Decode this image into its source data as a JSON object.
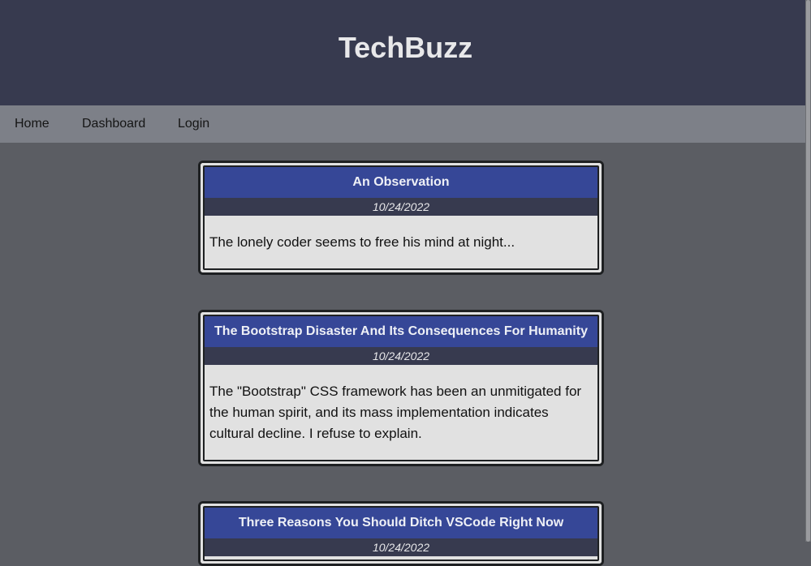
{
  "site": {
    "title": "TechBuzz"
  },
  "nav": {
    "items": [
      "Home",
      "Dashboard",
      "Login"
    ]
  },
  "posts": [
    {
      "title": "An Observation",
      "date": "10/24/2022",
      "body": "The lonely coder seems to free his mind at night..."
    },
    {
      "title": "The Bootstrap Disaster And Its Consequences For Humanity",
      "date": "10/24/2022",
      "body": "The \"Bootstrap\" CSS framework has been an unmitigated for the human spirit, and its mass implementation indicates cultural decline. I refuse to explain."
    },
    {
      "title": "Three Reasons You Should Ditch VSCode Right Now",
      "date": "10/24/2022",
      "body": ""
    }
  ],
  "colors": {
    "header_bg": "#373a4f",
    "nav_bg": "#7d8088",
    "page_bg": "#5b5d63",
    "card_title_bg": "#364797",
    "card_body_bg": "#e1e1e1"
  }
}
